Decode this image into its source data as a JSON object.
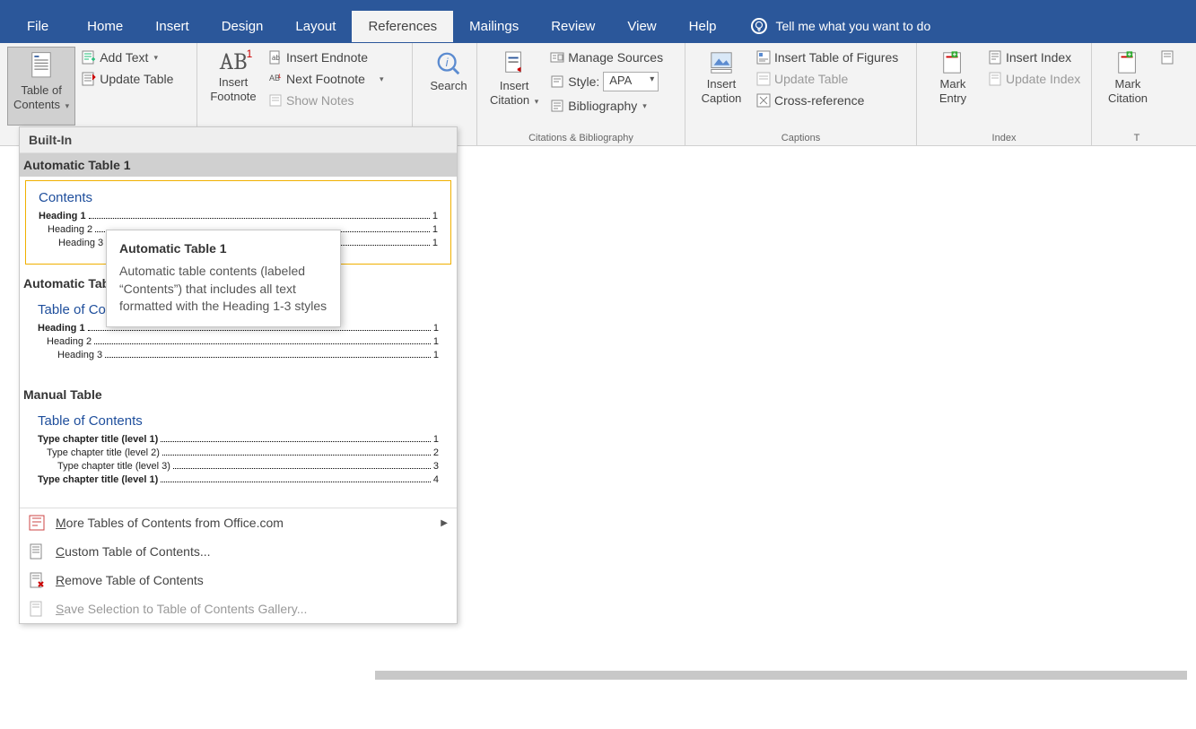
{
  "tabs": {
    "file": "File",
    "home": "Home",
    "insert": "Insert",
    "design": "Design",
    "layout": "Layout",
    "references": "References",
    "mailings": "Mailings",
    "review": "Review",
    "view": "View",
    "help": "Help",
    "tellme": "Tell me what you want to do"
  },
  "ribbon": {
    "toc": {
      "label": "Table of\nContents",
      "add_text": "Add Text",
      "update": "Update Table"
    },
    "footnotes": {
      "label": "Insert\nFootnote",
      "endnote": "Insert Endnote",
      "next": "Next Footnote",
      "show": "Show Notes"
    },
    "search": {
      "label": "Search",
      "group": ""
    },
    "citations": {
      "label": "Insert\nCitation",
      "manage": "Manage Sources",
      "style": "Style:",
      "style_val": "APA",
      "bib": "Bibliography",
      "group": "Citations & Bibliography"
    },
    "captions": {
      "label": "Insert\nCaption",
      "figs": "Insert Table of Figures",
      "update": "Update Table",
      "cross": "Cross-reference",
      "group": "Captions"
    },
    "index": {
      "label": "Mark\nEntry",
      "insert": "Insert Index",
      "update": "Update Index",
      "group": "Index"
    },
    "authorities": {
      "label": "Mark\nCitation"
    }
  },
  "dropdown": {
    "section": "Built-In",
    "item1": {
      "title": "Automatic Table 1",
      "heading": "Contents",
      "rows": [
        {
          "t": "Heading 1",
          "p": "1",
          "i": 0,
          "b": true
        },
        {
          "t": "Heading 2",
          "p": "1",
          "i": 1,
          "b": false
        },
        {
          "t": "Heading 3",
          "p": "1",
          "i": 2,
          "b": false
        }
      ]
    },
    "item2": {
      "title": "Automatic Table 2",
      "heading": "Table of Contents",
      "rows": [
        {
          "t": "Heading 1",
          "p": "1",
          "i": 0,
          "b": true
        },
        {
          "t": "Heading 2",
          "p": "1",
          "i": 1,
          "b": false
        },
        {
          "t": "Heading 3",
          "p": "1",
          "i": 2,
          "b": false
        }
      ]
    },
    "item3": {
      "title": "Manual Table",
      "heading": "Table of Contents",
      "rows": [
        {
          "t": "Type chapter title (level 1)",
          "p": "1",
          "i": 0,
          "b": true
        },
        {
          "t": "Type chapter title (level 2)",
          "p": "2",
          "i": 1,
          "b": false
        },
        {
          "t": "Type chapter title (level 3)",
          "p": "3",
          "i": 2,
          "b": false
        },
        {
          "t": "Type chapter title (level 1)",
          "p": "4",
          "i": 0,
          "b": true
        }
      ]
    },
    "more": "More Tables of Contents from Office.com",
    "custom": "Custom Table of Contents...",
    "remove": "Remove Table of Contents",
    "save": "Save Selection to Table of Contents Gallery..."
  },
  "tooltip": {
    "title": "Automatic Table 1",
    "body": "Automatic table contents (labeled “Contents”) that includes all text formatted with the Heading 1-3 styles"
  }
}
